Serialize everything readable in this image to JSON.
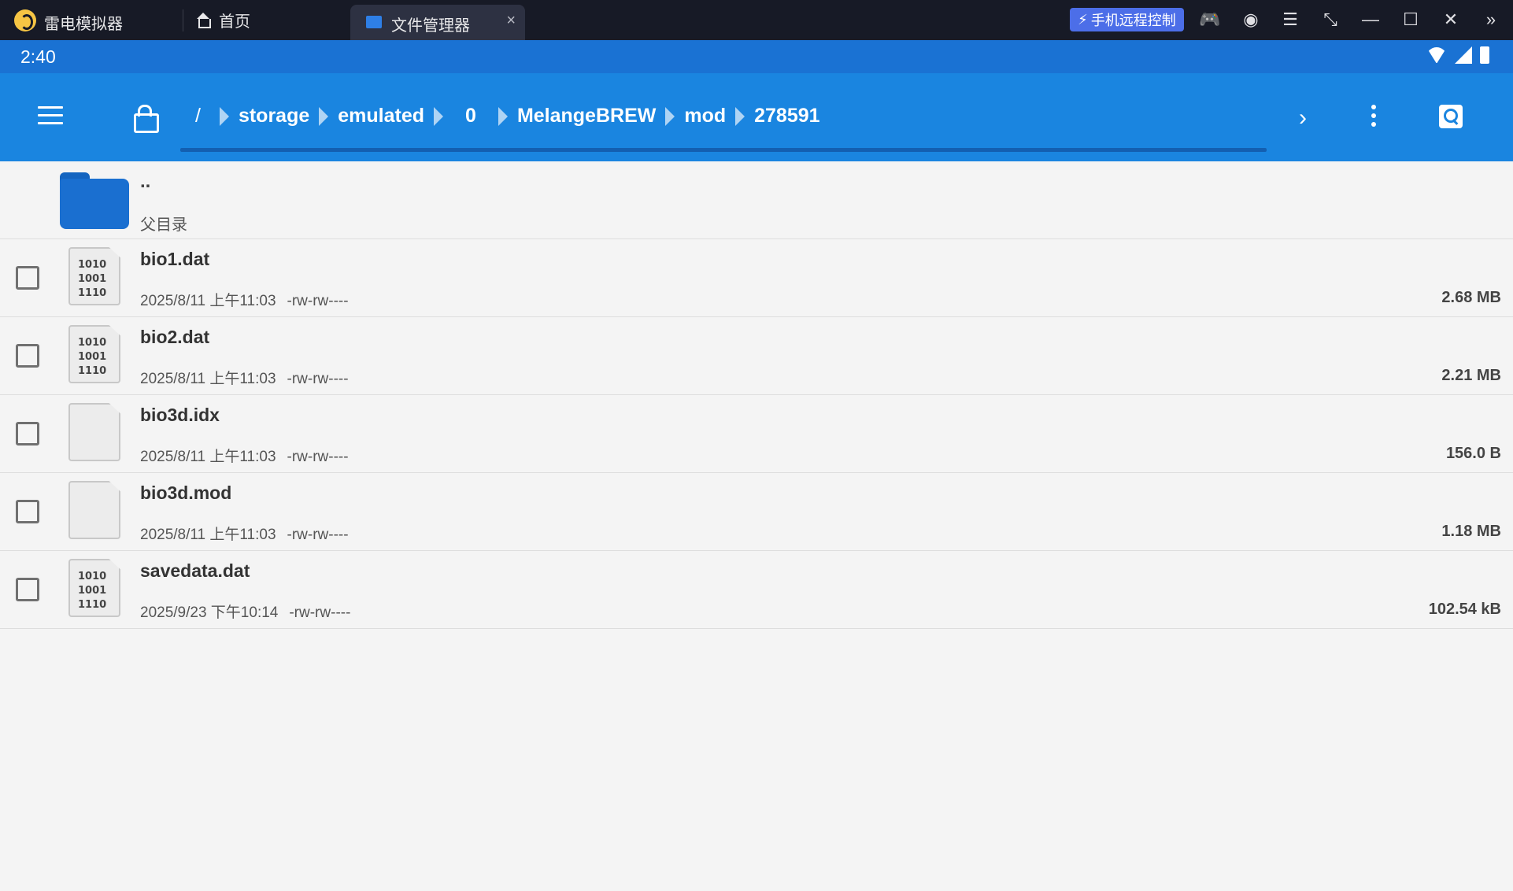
{
  "window": {
    "app_name": "雷电模拟器",
    "tabs": [
      {
        "label": "首页"
      },
      {
        "label": "文件管理器",
        "close": "×"
      }
    ],
    "remote_control_label": "手机远程控制"
  },
  "status_bar": {
    "time": "2:40"
  },
  "toolbar": {
    "breadcrumb": [
      "/",
      "storage",
      "emulated",
      "0",
      "MelangeBREW",
      "mod",
      "278591"
    ]
  },
  "parent": {
    "name": "..",
    "label": "父目录"
  },
  "files": [
    {
      "name": "bio1.dat",
      "date": "2025/8/11 上午11:03",
      "perm": "-rw-rw----",
      "size": "2.68 MB",
      "icon": "binary-file-icon"
    },
    {
      "name": "bio2.dat",
      "date": "2025/8/11 上午11:03",
      "perm": "-rw-rw----",
      "size": "2.21 MB",
      "icon": "binary-file-icon"
    },
    {
      "name": "bio3d.idx",
      "date": "2025/8/11 上午11:03",
      "perm": "-rw-rw----",
      "size": "156.0 B",
      "icon": "blank-file-icon"
    },
    {
      "name": "bio3d.mod",
      "date": "2025/8/11 上午11:03",
      "perm": "-rw-rw----",
      "size": "1.18 MB",
      "icon": "blank-file-icon"
    },
    {
      "name": "savedata.dat",
      "date": "2025/9/23 下午10:14",
      "perm": "-rw-rw----",
      "size": "102.54 kB",
      "icon": "binary-file-icon"
    }
  ],
  "binary_glyph": [
    "1010",
    "1001",
    "1110"
  ],
  "colors": {
    "titlebar": "#171a26",
    "status_bar": "#1a72d3",
    "toolbar": "#1a85e0",
    "remote_button": "#4c6ee8",
    "folder": "#1a6fd0"
  }
}
